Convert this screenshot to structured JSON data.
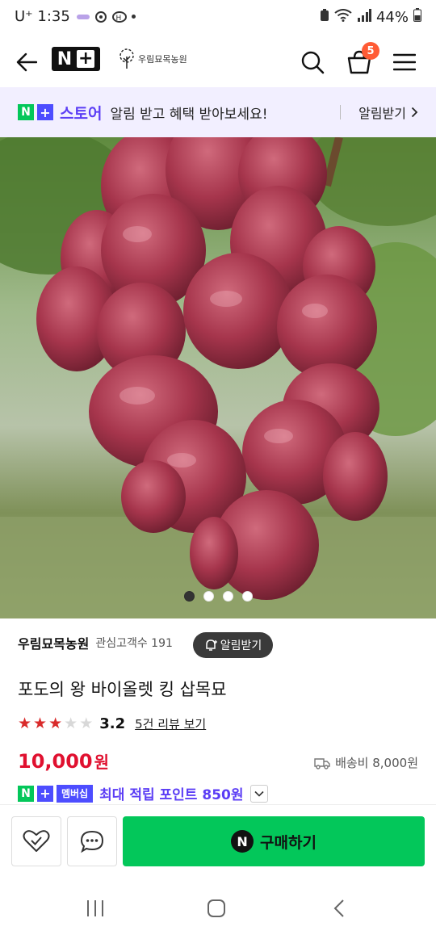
{
  "status_bar": {
    "carrier": "U⁺ 1:35",
    "battery": "44%"
  },
  "header": {
    "logo_text": "N",
    "farm_logo_text": "우림묘목농원",
    "cart_count": "5",
    "icons": [
      "back-arrow-icon",
      "search-icon",
      "cart-icon",
      "menu-icon"
    ]
  },
  "banner": {
    "store_n": "N",
    "store_plus": "+",
    "store_name": "스토어",
    "message": "알림 받고 혜택 받아보세요!",
    "cta": "알림받기"
  },
  "carousel": {
    "image_description": "grape photo",
    "total": 4,
    "active_index": 0
  },
  "product": {
    "seller_name": "우림묘목농원",
    "followers": "관심고객수 191",
    "alert_button": "알림받기",
    "title": "포도의 왕 바이올렛 킹 삽목묘",
    "rating": "3.2",
    "rating_stars": 3,
    "reviews_link": "5건 리뷰 보기",
    "price": "10,000",
    "price_unit": "원",
    "shipping": "배송비 8,000원",
    "member_tag": "멤버십",
    "points": "최대 적립 포인트 850원"
  },
  "action_bar": {
    "buy_icon_letter": "N",
    "buy_label": "구매하기"
  },
  "colors": {
    "naver_green": "#03c75a",
    "plus_purple": "#5b3df5",
    "price_red": "#e0102f",
    "cart_badge": "#ff5b35"
  }
}
